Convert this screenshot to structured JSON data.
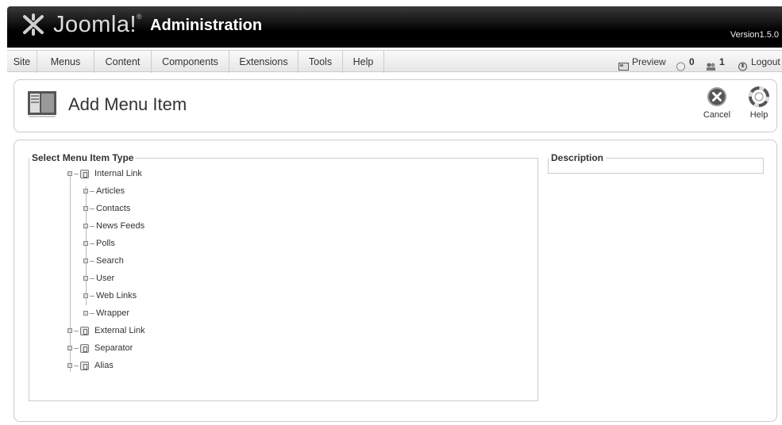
{
  "header": {
    "logo_text": "Joomla!",
    "logo_tm": "®",
    "admin_title": "Administration",
    "version": "Version1.5.0"
  },
  "menu": {
    "items": [
      "Site",
      "Menus",
      "Content",
      "Components",
      "Extensions",
      "Tools",
      "Help"
    ]
  },
  "status": {
    "preview": "Preview",
    "messages_count": "0",
    "users_count": "1",
    "logout": "Logout"
  },
  "toolbar": {
    "title": "Add Menu Item",
    "cancel_label": "Cancel",
    "help_label": "Help"
  },
  "select_type": {
    "legend": "Select Menu Item Type",
    "tree": {
      "internal": "Internal Link",
      "children": [
        "Articles",
        "Contacts",
        "News Feeds",
        "Polls",
        "Search",
        "User",
        "Web Links",
        "Wrapper"
      ],
      "external": "External Link",
      "separator": "Separator",
      "alias": "Alias"
    }
  },
  "description": {
    "legend": "Description"
  }
}
